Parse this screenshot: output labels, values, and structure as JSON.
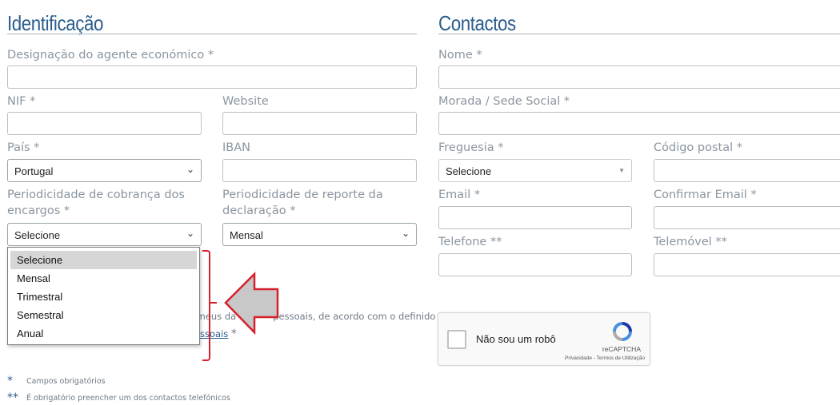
{
  "identificacao": {
    "title": "Identificação",
    "designacao_label": "Designação do agente económico",
    "nif_label": "NIF",
    "website_label": "Website",
    "pais_label": "País",
    "pais_value": "Portugal",
    "iban_label": "IBAN",
    "periodicidade_cobranca_label_line1": "Periodicidade de cobrança dos",
    "periodicidade_cobranca_label_line2": "encargos",
    "periodicidade_cobranca_value": "Selecione",
    "periodicidade_reporte_label_line1": "Periodicidade de reporte da",
    "periodicidade_reporte_label_line2": "declaração",
    "periodicidade_reporte_value": "Mensal"
  },
  "dropdown": {
    "options": [
      "Selecione",
      "Mensal",
      "Trimestral",
      "Semestral",
      "Anual"
    ]
  },
  "consent": {
    "text_fragment": "s meus da",
    "text_fragment2": "pessoais, de acordo com o definido",
    "link_fragment": "ssoais",
    "required_mark": "*"
  },
  "contactos": {
    "title": "Contactos",
    "nome_label": "Nome",
    "morada_label": "Morada / Sede Social",
    "freguesia_label": "Freguesia",
    "freguesia_value": "Selecione",
    "codigo_postal_label": "Código postal",
    "email_label": "Email",
    "confirmar_email_label": "Confirmar Email",
    "telefone_label": "Telefone",
    "telemovel_label": "Telemóvel"
  },
  "required_mark": "*",
  "phone_mark": "**",
  "captcha": {
    "label": "Não sou um robô",
    "brand": "reCAPTCHA",
    "terms": "Privacidade - Termos de Utilização"
  },
  "footnotes": {
    "single_mark": "*",
    "single_text": "Campos obrigatórios",
    "double_mark": "**",
    "double_text": "É obrigatório preencher um dos contactos telefónicos"
  },
  "colors": {
    "title": "#2a5d8c",
    "annotation": "#d6202b",
    "arrow_fill": "#c8c8c8"
  }
}
